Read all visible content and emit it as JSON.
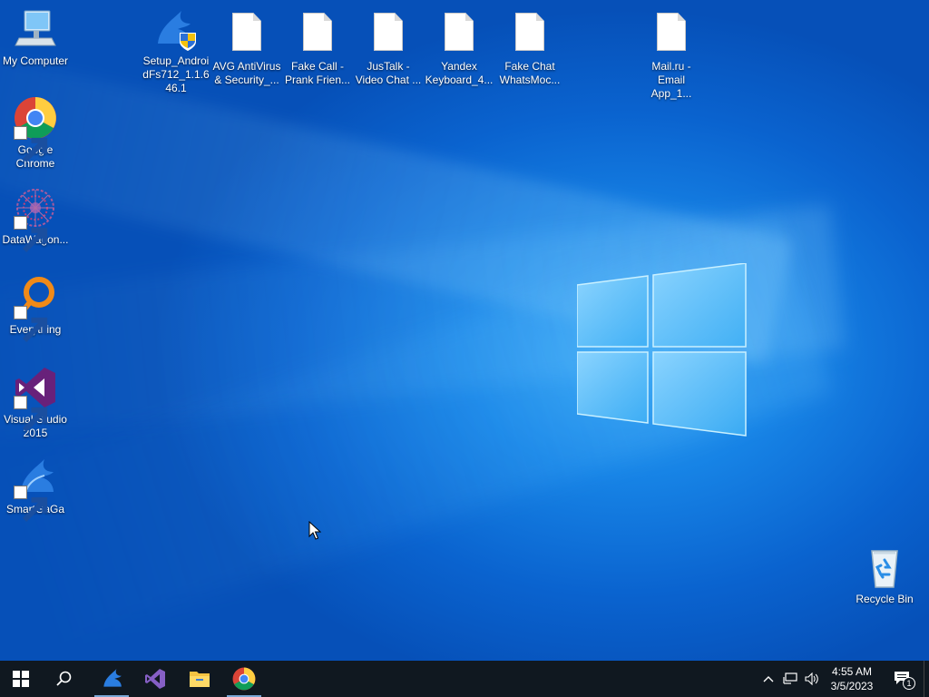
{
  "desktop": {
    "left_icons": [
      {
        "label": "My Computer",
        "icon": "computer-icon"
      },
      {
        "label": "Google Chrome",
        "icon": "chrome-icon"
      },
      {
        "label": "DataWagon...",
        "icon": "datawagon-icon"
      },
      {
        "label": "Everything",
        "icon": "everything-search-icon"
      },
      {
        "label": "Visual Studio 2015",
        "icon": "visual-studio-icon"
      },
      {
        "label": "SmartGaGa",
        "icon": "smartgaga-icon"
      }
    ],
    "top_icons": [
      {
        "label": "Setup_AndroidFs712_1.1.646.1",
        "icon": "installer-icon"
      },
      {
        "label": "AVG AntiVirus & Security_...",
        "icon": "file-icon"
      },
      {
        "label": "Fake Call - Prank Frien...",
        "icon": "file-icon"
      },
      {
        "label": "JusTalk - Video Chat ...",
        "icon": "file-icon"
      },
      {
        "label": "Yandex Keyboard_4...",
        "icon": "file-icon"
      },
      {
        "label": "Fake Chat WhatsMoc...",
        "icon": "file-icon"
      },
      {
        "label": "Mail.ru - Email App_1...",
        "icon": "file-icon"
      }
    ],
    "recycle_bin": {
      "label": "Recycle Bin",
      "icon": "recycle-bin-icon"
    }
  },
  "taskbar": {
    "apps": [
      {
        "name": "start",
        "icon": "windows-start-icon"
      },
      {
        "name": "search",
        "icon": "search-icon"
      },
      {
        "name": "smartgaga",
        "icon": "smartgaga-icon",
        "active": true
      },
      {
        "name": "visual-studio",
        "icon": "visual-studio-icon"
      },
      {
        "name": "file-explorer",
        "icon": "folder-icon"
      },
      {
        "name": "chrome",
        "icon": "chrome-icon",
        "active": true
      }
    ],
    "tray": {
      "time": "4:55 AM",
      "date": "3/5/2023",
      "notification_count": "1",
      "icons": [
        "chevron-up-icon",
        "network-icon",
        "volume-icon"
      ]
    }
  }
}
